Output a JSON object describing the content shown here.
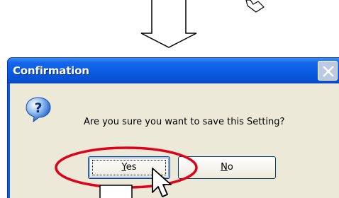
{
  "dialog": {
    "title": "Confirmation",
    "message": "Are you sure you want to save this Setting?",
    "buttons": {
      "yes": {
        "mnemonic": "Y",
        "rest": "es"
      },
      "no": {
        "mnemonic": "N",
        "rest": "o"
      }
    },
    "icon": "question-icon",
    "close_icon": "close-icon"
  },
  "annotations": {
    "arrows": [
      "down-arrow",
      "up-arrow"
    ],
    "cursors": [
      "mouse-pointer-icon",
      "mouse-pointer-icon"
    ],
    "highlight": "red-ellipse",
    "highlight_color": "#e0001a"
  },
  "colors": {
    "titlebar": "#0a5ce0",
    "client": "#ece9d8",
    "button_border": "#003c74"
  }
}
